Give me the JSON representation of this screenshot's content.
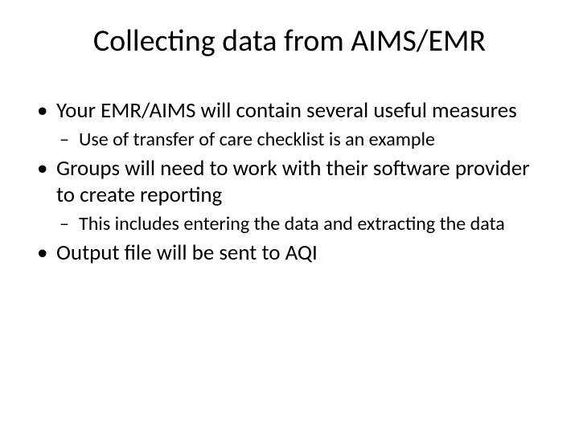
{
  "slide": {
    "title": "Collecting data from AIMS/EMR",
    "bullets": [
      {
        "text": "Your EMR/AIMS will contain several useful measures",
        "sub": [
          {
            "text": "Use of transfer of care checklist is an example"
          }
        ]
      },
      {
        "text": "Groups will need to work with their software provider to create reporting",
        "sub": [
          {
            "text": "This includes entering the data and extracting the data"
          }
        ]
      },
      {
        "text": "Output file will be sent to AQI",
        "sub": []
      }
    ]
  }
}
